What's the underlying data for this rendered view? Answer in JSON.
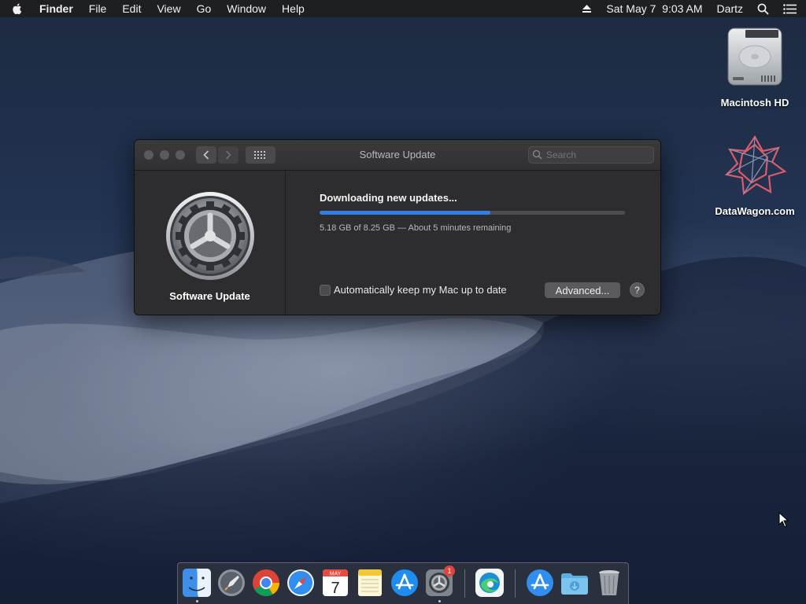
{
  "menubar": {
    "app_name": "Finder",
    "menus": [
      "File",
      "Edit",
      "View",
      "Go",
      "Window",
      "Help"
    ],
    "clock": "Sat May 7  9:03 AM",
    "user": "Dartz"
  },
  "desktop": {
    "icons": [
      {
        "label": "Macintosh HD",
        "icon": "hard-drive-icon"
      },
      {
        "label": "DataWagon.com",
        "icon": "datawagon-logo-icon"
      }
    ]
  },
  "window": {
    "title": "Software Update",
    "search_placeholder": "Search",
    "sidebar_title": "Software Update",
    "status": "Downloading new updates...",
    "progress_fraction": 0.56,
    "detail": "5.18 GB of 8.25 GB — About 5 minutes remaining",
    "auto_update_label": "Automatically keep my Mac up to date",
    "auto_update_checked": false,
    "advanced_button": "Advanced...",
    "help_button": "?"
  },
  "dock": {
    "items": [
      {
        "name": "Finder",
        "icon": "finder-icon",
        "running": true
      },
      {
        "name": "Launchpad",
        "icon": "launchpad-icon",
        "running": false
      },
      {
        "name": "Google Chrome",
        "icon": "chrome-icon",
        "running": false
      },
      {
        "name": "Safari",
        "icon": "safari-icon",
        "running": false
      },
      {
        "name": "Calendar",
        "icon": "calendar-icon",
        "running": false,
        "month": "MAY",
        "day": "7"
      },
      {
        "name": "Notes",
        "icon": "notes-icon",
        "running": false
      },
      {
        "name": "App Store",
        "icon": "app-store-icon",
        "running": false
      },
      {
        "name": "System Preferences",
        "icon": "system-preferences-icon",
        "running": true,
        "badge": "1"
      },
      {
        "name": "Microsoft Edge",
        "icon": "edge-icon",
        "running": false
      },
      {
        "name": "Applications",
        "icon": "applications-folder-icon",
        "running": false
      },
      {
        "name": "Downloads",
        "icon": "downloads-folder-icon",
        "running": false
      },
      {
        "name": "Trash",
        "icon": "trash-icon",
        "running": false
      }
    ]
  },
  "colors": {
    "accent": "#2f7fe8",
    "window_bg": "#2d2d2f",
    "badge": "#e0443e"
  }
}
